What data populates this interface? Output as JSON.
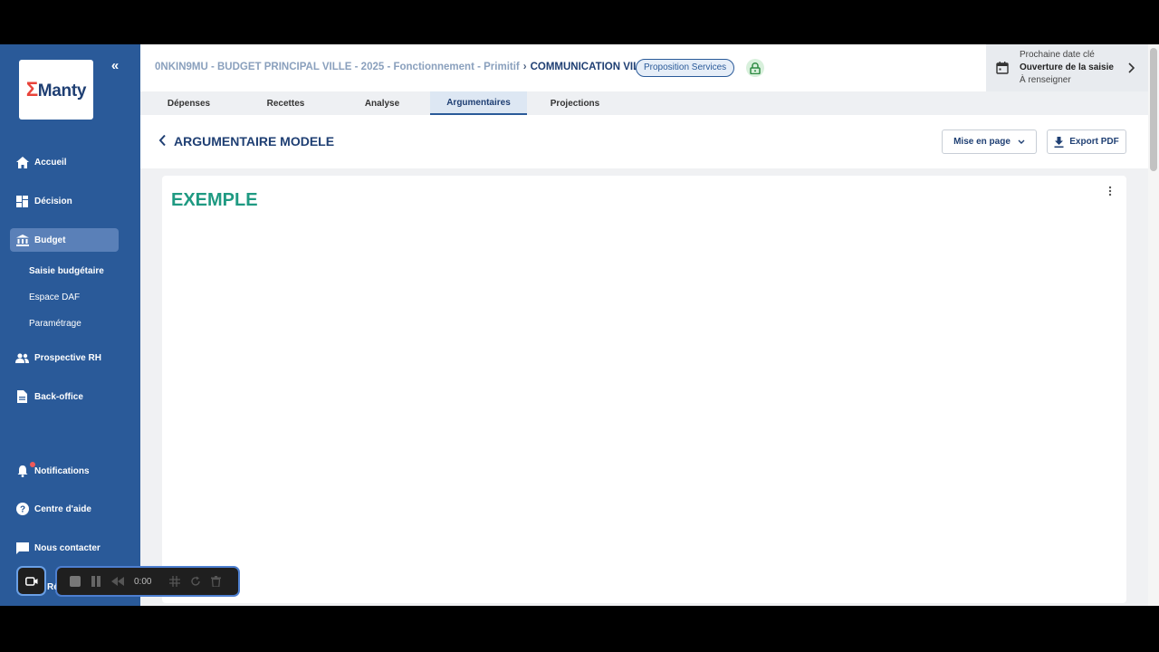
{
  "sidebar": {
    "logo": "Manty",
    "logo_sigma": "Σ",
    "nav": [
      {
        "label": "Accueil",
        "icon": "home-icon"
      },
      {
        "label": "Décision",
        "icon": "dashboard-icon"
      },
      {
        "label": "Budget",
        "icon": "bank-icon",
        "active": true
      },
      {
        "label": "Prospective RH",
        "icon": "people-icon"
      },
      {
        "label": "Back-office",
        "icon": "document-icon"
      }
    ],
    "budget_sub": [
      {
        "label": "Saisie budgétaire",
        "active": true
      },
      {
        "label": "Espace DAF"
      },
      {
        "label": "Paramétrage"
      }
    ],
    "bottom": [
      {
        "label": "Notifications",
        "icon": "bell-icon"
      },
      {
        "label": "Centre d'aide",
        "icon": "help-icon"
      },
      {
        "label": "Nous contacter",
        "icon": "chat-icon"
      }
    ],
    "partial_label": "Réglages"
  },
  "header": {
    "breadcrumb_path": "0NKIN9MU - BUDGET PRINCIPAL VILLE - 2025 - Fonctionnement - Primitif",
    "breadcrumb_sep": "›",
    "breadcrumb_current": "COMMUNICATION VILLE",
    "status_badge": "Proposition Services",
    "keydate": {
      "line1": "Prochaine date clé",
      "line2": "Ouverture de la saisie",
      "line3": "À renseigner"
    }
  },
  "tabs": [
    {
      "label": "Dépenses"
    },
    {
      "label": "Recettes"
    },
    {
      "label": "Analyse"
    },
    {
      "label": "Argumentaires",
      "active": true
    },
    {
      "label": "Projections"
    }
  ],
  "titlebar": {
    "title": "ARGUMENTAIRE MODELE",
    "layout_button": "Mise en page",
    "export_button": "Export PDF"
  },
  "document": {
    "heading": "EXEMPLE"
  },
  "recorder": {
    "time": "0:00"
  },
  "colors": {
    "sidebar": "#2a5a99",
    "title": "#1f3f73",
    "heading": "#1f9a82",
    "badge_border": "#2a5a99",
    "notification_dot": "#f05a5a"
  }
}
